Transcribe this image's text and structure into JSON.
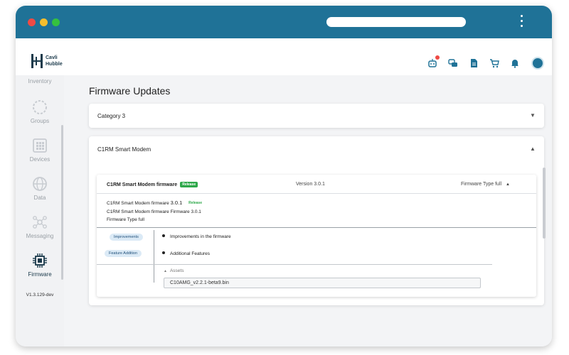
{
  "header": {
    "logo_line1": "Cavli",
    "logo_line2": "Hubble",
    "icons": [
      "robot-icon",
      "chat-icon",
      "document-icon",
      "cart-icon",
      "bell-icon",
      "avatar"
    ]
  },
  "sidebar": {
    "items": [
      {
        "label": "Inventory",
        "icon": "inventory-icon"
      },
      {
        "label": "Groups",
        "icon": "groups-icon"
      },
      {
        "label": "Devices",
        "icon": "devices-icon"
      },
      {
        "label": "Data",
        "icon": "globe-icon"
      },
      {
        "label": "Messaging",
        "icon": "messaging-icon"
      },
      {
        "label": "Firmware",
        "icon": "chip-icon",
        "active": true
      }
    ],
    "version": "V1.3.129-dev"
  },
  "main": {
    "title": "Firmware Updates",
    "categories": [
      {
        "label": "Category 3",
        "expanded": false
      },
      {
        "label": "C1RM Smart Modem",
        "expanded": true
      }
    ],
    "firmware": {
      "name": "C1RM Smart Modem firmware",
      "tag": "Release",
      "version": "Version 3.0.1",
      "type": "Firmware Type full",
      "details_line1": "C1RM Smart Modem firmware",
      "details_version": "3.0.1",
      "details_tag": "Release",
      "details_line2": "C1RM Smart Modem firmware Firmware 3.0.1",
      "details_line3": "Firmware Type full",
      "notes": [
        {
          "pill": "Improvements",
          "text": "Improvements in the firmware"
        },
        {
          "pill": "Feature Addition",
          "text": "Additional Features"
        }
      ],
      "assets_label": "Assets",
      "asset_file": "C10AMG_v2.2.1-beta9.bin"
    }
  },
  "colors": {
    "titlebar": "#1f7297",
    "accent": "#1f7297",
    "release_tag": "#2ea84a",
    "badge": "#ef4a44"
  }
}
